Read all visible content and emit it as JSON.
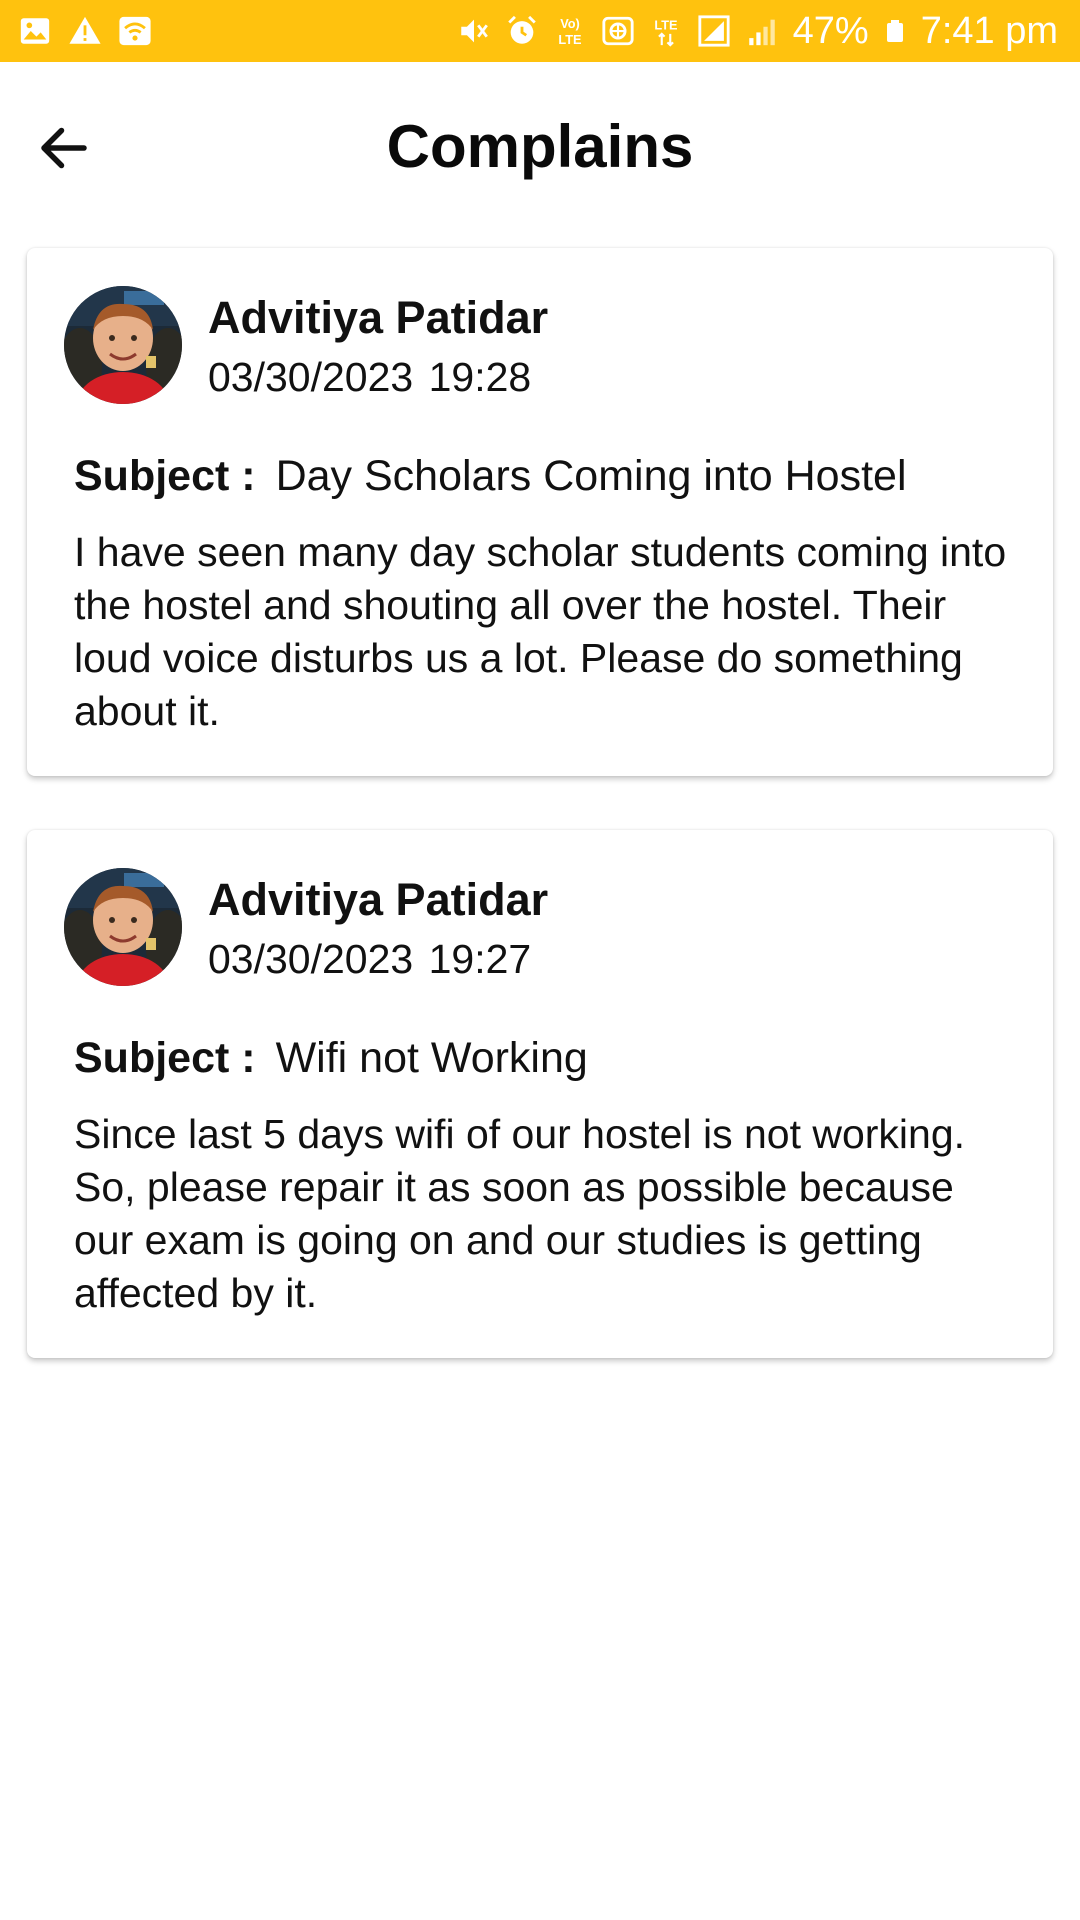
{
  "status_bar": {
    "battery_percent": "47%",
    "time": "7:41 pm",
    "background_color": "#FFC20E",
    "icons_left": [
      "gallery-icon",
      "warning-icon",
      "wifi-hotspot-icon"
    ],
    "icons_right": [
      "mute-icon",
      "alarm-icon",
      "volte-icon",
      "vpn-icon",
      "lte-data-icon",
      "signal-icon",
      "signal-weak-icon",
      "battery-icon"
    ],
    "volte_label": "Vo)) LTE",
    "lte_label": "LTE"
  },
  "header": {
    "back_icon": "arrow-left-icon",
    "title": "Complains"
  },
  "complaints": [
    {
      "author": "Advitiya Patidar",
      "date": "03/30/2023",
      "time": "19:28",
      "timestamp": "03/30/2023  19:28",
      "subject_label": "Subject :",
      "subject": "Day Scholars Coming into Hostel",
      "description": "I have seen many day scholar students coming into the hostel and shouting all over the hostel. Their loud voice disturbs us a lot. Please do something about it."
    },
    {
      "author": "Advitiya Patidar",
      "date": "03/30/2023",
      "time": "19:27",
      "timestamp": "03/30/2023  19:27",
      "subject_label": "Subject :",
      "subject": "Wifi not Working",
      "description": "Since last 5 days wifi of our hostel is not working. So, please repair it as soon as possible because our exam is going on and our studies is getting affected by it."
    }
  ]
}
